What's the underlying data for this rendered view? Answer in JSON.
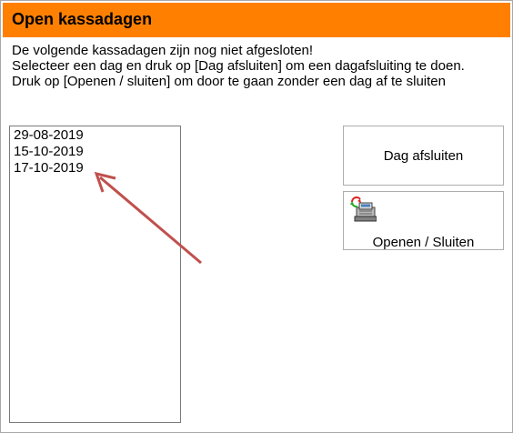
{
  "window": {
    "title": "Open kassadagen"
  },
  "message": {
    "line1": "De volgende kassadagen zijn nog niet afgesloten!",
    "line2": "Selecteer een dag en druk op [Dag afsluiten] om een dagafsluiting te doen.",
    "line3": "Druk op [Openen / sluiten] om door te gaan zonder een dag af te sluiten"
  },
  "days": [
    "29-08-2019",
    "15-10-2019",
    "17-10-2019"
  ],
  "buttons": {
    "close_day": "Dag afsluiten",
    "open_close": "Openen / Sluiten"
  },
  "icons": {
    "open_close": "cash-register-icon",
    "annotation": "annotation-arrow"
  },
  "colors": {
    "titlebar": "#ff8000",
    "arrow": "#c0504d"
  }
}
